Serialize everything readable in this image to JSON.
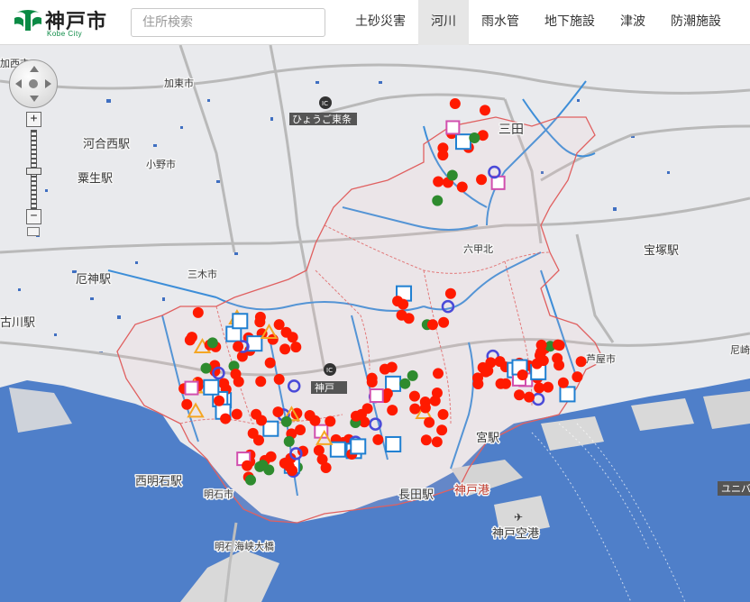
{
  "header": {
    "logo_text": "神戸市",
    "logo_sub": "Kobe City",
    "search_placeholder": "住所検索",
    "nav": [
      {
        "label": "土砂災害",
        "active": false
      },
      {
        "label": "河川",
        "active": true
      },
      {
        "label": "雨水管",
        "active": false
      },
      {
        "label": "地下施設",
        "active": false
      },
      {
        "label": "津波",
        "active": false
      },
      {
        "label": "防潮施設",
        "active": false
      }
    ]
  },
  "map": {
    "labels": {
      "kato": "加東市",
      "kasaihigashi": "加西市",
      "kawainishi": "河合西駅",
      "ono": "小野市",
      "awao": "粟生駅",
      "yakujin": "厄神駅",
      "miki": "三木市",
      "kakogawa": "古川駅",
      "hyogo_east": "ひょうご東条",
      "sanda": "三田",
      "rokko": "六甲北",
      "takarazuka": "宝塚駅",
      "ashiya": "芦屋市",
      "amagasaki": "尼崎",
      "kobe_ic": "神戸",
      "sannomiya": "宮駅",
      "kobe_port": "神戸港",
      "kobe_airport": "神戸空港",
      "nishiakashi": "西明石駅",
      "akashi": "明石市",
      "nagata": "長田駅",
      "akashi_bridge": "明石海峡大橋",
      "universal": "ユニバ"
    },
    "legend_colors": {
      "hazard_point": "#ff1a00",
      "river_icon": "#1f7fd1",
      "water_level_icon": "#d14fae",
      "warning_icon": "#f5a623",
      "green_point": "#2e8b2e",
      "boundary": "#e06060",
      "river": "#3d8ed8",
      "sea": "#4f7fc9",
      "road": "#b7b7b7"
    },
    "icons": {
      "zoom_in": "+",
      "zoom_out": "−",
      "pan": "pan-control-icon"
    }
  }
}
